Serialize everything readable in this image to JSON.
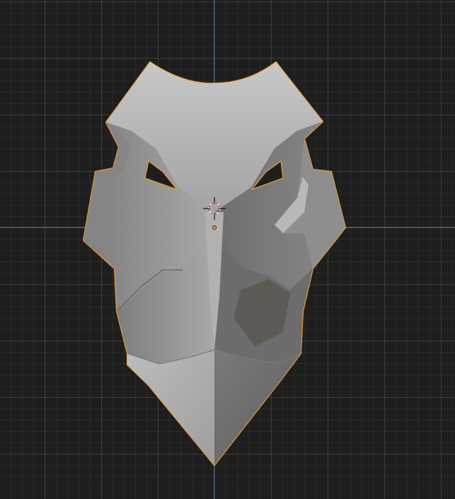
{
  "viewport": {
    "background_color": "#1e1e1e",
    "grid_color": "#3a3a3a",
    "x_axis_color": "#a84848",
    "z_axis_color": "#3e6aa8"
  },
  "object": {
    "type": "mesh",
    "shape": "bird-mask",
    "selected": true,
    "outline_color": "#f29a2e",
    "shading": "solid",
    "base_color": "#9a9a9a"
  },
  "cursor_3d": {
    "icon": "3d-cursor-icon",
    "colors": [
      "#ffffff",
      "#e04040"
    ]
  },
  "origin": {
    "icon": "object-origin-icon",
    "color": "#f29a2e"
  }
}
